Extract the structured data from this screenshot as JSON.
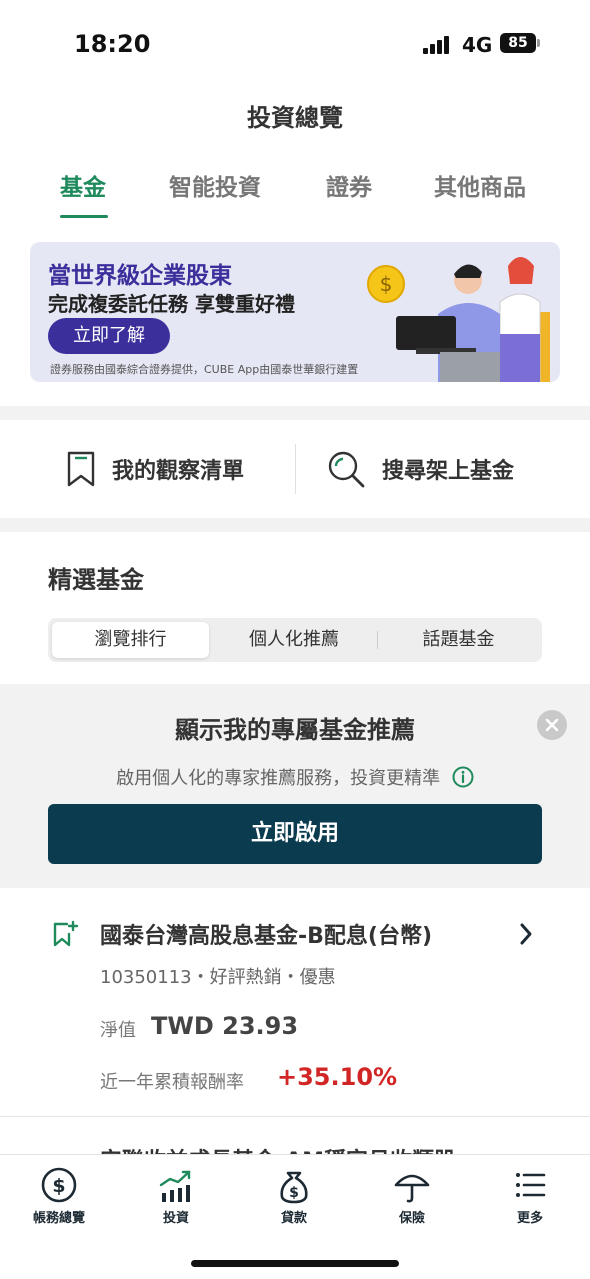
{
  "status": {
    "time": "18:20",
    "network": "4G",
    "battery": "85"
  },
  "header": {
    "title": "投資總覽",
    "tabs": [
      {
        "label": "基金",
        "active": true
      },
      {
        "label": "智能投資"
      },
      {
        "label": "證券"
      },
      {
        "label": "其他商品"
      }
    ]
  },
  "banner": {
    "title": "當世界級企業股東",
    "subtitle": "完成複委託任務 享雙重好禮",
    "button": "立即了解",
    "note": "證券服務由國泰綜合證券提供，CUBE App由國泰世華銀行建置"
  },
  "quick_links": {
    "watchlist": "我的觀察清單",
    "search": "搜尋架上基金"
  },
  "featured": {
    "title": "精選基金",
    "segments": [
      "瀏覽排行",
      "個人化推薦",
      "話題基金"
    ]
  },
  "promo": {
    "title": "顯示我的專屬基金推薦",
    "description": "啟用個人化的專家推薦服務，投資更精準",
    "button": "立即啟用"
  },
  "fund": {
    "name": "國泰台灣高股息基金-B配息(台幣)",
    "meta": "10350113・好評熱銷・優惠",
    "nav_label": "淨值",
    "nav_value": "TWD 23.93",
    "return_label": "近一年累積報酬率",
    "return_value": "+35.10%",
    "next_peek": "安聯收益成長基金-AM穩定月收類股"
  },
  "tabbar": {
    "items": [
      "帳務總覽",
      "投資",
      "貸款",
      "保險",
      "更多"
    ]
  },
  "colors": {
    "accent_green": "#1f8a5b",
    "banner_purple": "#3b2f9c",
    "primary_button": "#0b3b4f",
    "return_red": "#d22626"
  }
}
